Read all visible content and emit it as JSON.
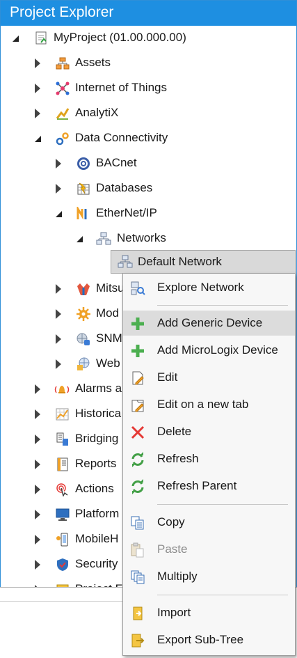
{
  "panel": {
    "title": "Project Explorer"
  },
  "tree": {
    "root": "MyProject (01.00.000.00)",
    "assets": "Assets",
    "iot": "Internet of Things",
    "analytix": "AnalytiX",
    "data_connectivity": "Data Connectivity",
    "bacnet": "BACnet",
    "databases": "Databases",
    "ethernetip": "EtherNet/IP",
    "networks": "Networks",
    "default_network": "Default Network",
    "mitsu": "Mitsu",
    "mod": "Mod",
    "snm": "SNM",
    "web": "Web",
    "alarms": "Alarms a",
    "historical": "Historica",
    "bridging": "Bridging",
    "reports": "Reports",
    "actions": "Actions",
    "platform": "Platform",
    "mobile": "MobileH",
    "security": "Security",
    "project_f": "Project F"
  },
  "context_menu": {
    "explore_network": "Explore Network",
    "add_generic_device": "Add Generic Device",
    "add_micrologix_device": "Add MicroLogix Device",
    "edit": "Edit",
    "edit_new_tab": "Edit on a new tab",
    "delete": "Delete",
    "refresh": "Refresh",
    "refresh_parent": "Refresh Parent",
    "copy": "Copy",
    "paste": "Paste",
    "multiply": "Multiply",
    "import": "Import",
    "export_subtree": "Export Sub-Tree"
  },
  "colors": {
    "accent": "#1e8fe1",
    "highlight": "#dcdcdc",
    "add_green": "#4caf50",
    "delete_red": "#e53935",
    "refresh_green": "#43a047"
  }
}
